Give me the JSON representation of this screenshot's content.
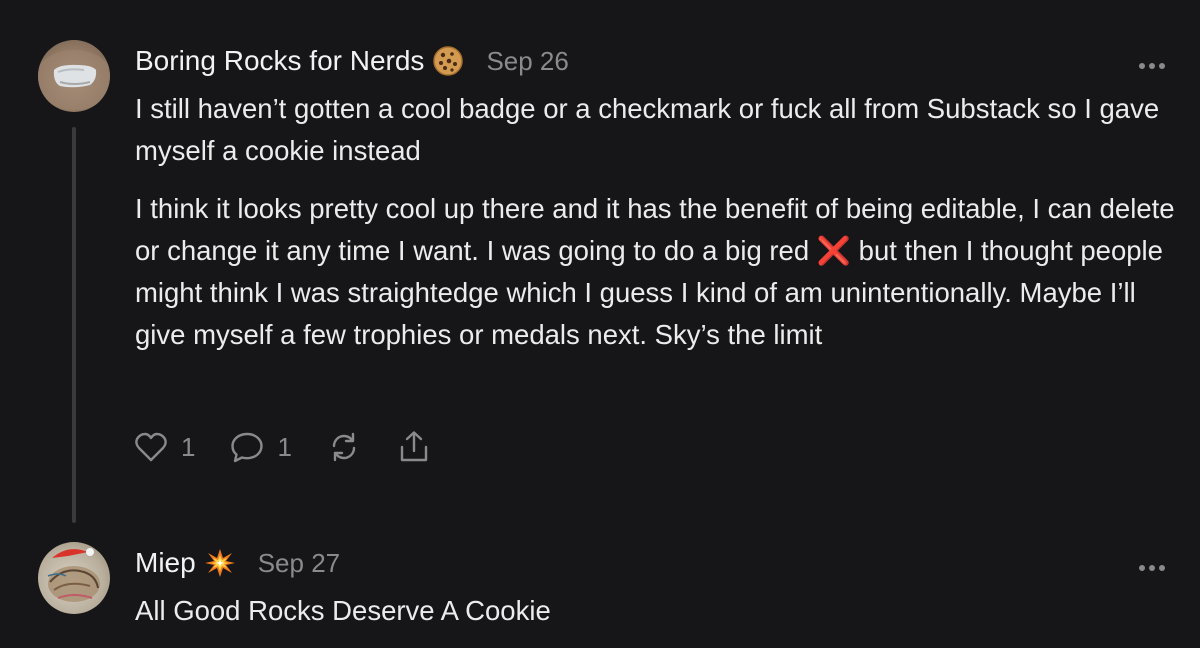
{
  "comments": [
    {
      "author": "Boring Rocks for Nerds",
      "badge_icon": "cookie-icon",
      "date": "Sep 26",
      "paragraphs": [
        "I still haven’t gotten a cool badge or a checkmark or fuck all from Substack so I gave myself a cookie instead",
        "I think it looks pretty cool up there and it has the benefit of being editable, I can delete or change it any time I want. I was going to do a big red ❌ but then I thought people might think I was straightedge which I guess I kind of am unintentionally. Maybe I’ll give myself a few trophies or medals next. Sky’s the limit"
      ],
      "likes": "1",
      "replies": "1"
    },
    {
      "author": "Miep",
      "badge_icon": "collision-icon",
      "date": "Sep 27",
      "paragraphs": [
        "All Good Rocks Deserve A Cookie"
      ]
    }
  ]
}
